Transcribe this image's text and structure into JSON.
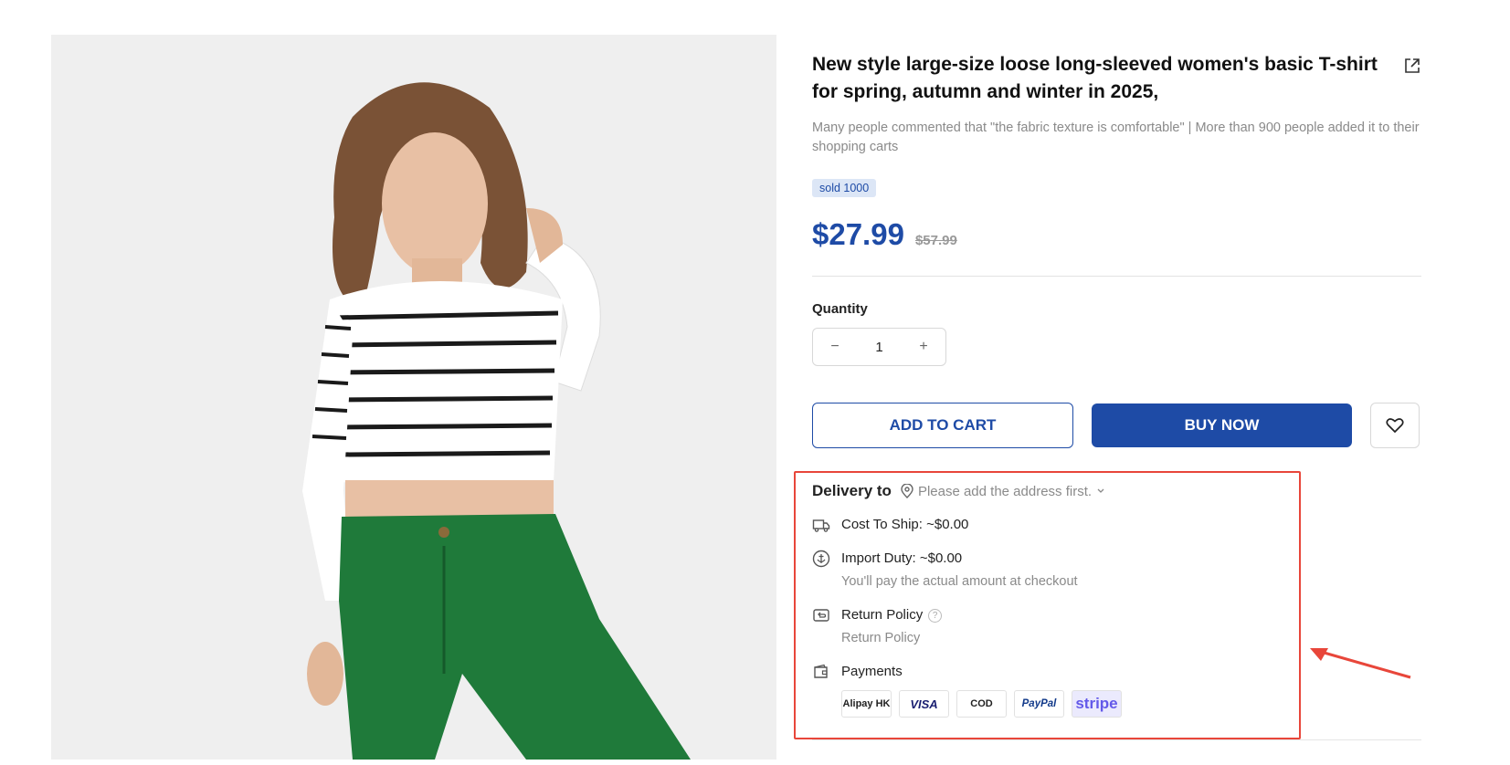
{
  "product": {
    "title": "New style large-size loose long-sleeved women's basic T-shirt for spring, autumn and winter in 2025,",
    "subtitle": "Many people commented that \"the fabric texture is comfortable\" | More than 900 people added it to their shopping carts",
    "badge": "sold 1000",
    "price": "$27.99",
    "old_price": "$57.99",
    "image_icon": "model-photo"
  },
  "quantity": {
    "label": "Quantity",
    "value": "1",
    "minus": "−",
    "plus": "+"
  },
  "actions": {
    "add_to_cart": "ADD TO CART",
    "buy_now": "BUY NOW",
    "wishlist_icon": "heart-icon"
  },
  "delivery": {
    "title": "Delivery to",
    "address_placeholder": "Please add the address first.",
    "shipping": "Cost To Ship: ~$0.00",
    "duty": "Import Duty: ~$0.00",
    "duty_note": "You'll pay the actual amount at checkout",
    "return_title": "Return Policy",
    "return_note": "Return Policy",
    "help": "?",
    "payments_title": "Payments",
    "payment_methods": [
      "Alipay HK",
      "VISA",
      "COD",
      "PayPal",
      "stripe"
    ]
  },
  "colors": {
    "accent": "#1e4ba6",
    "highlight_box": "#e8463a"
  }
}
